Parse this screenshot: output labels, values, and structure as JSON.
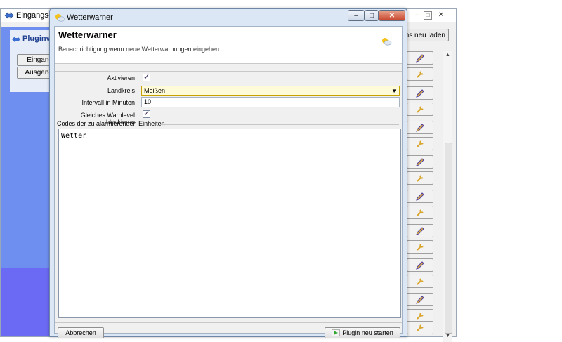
{
  "background_window": {
    "title": "Eingangs- u",
    "panel_title": "Pluginve",
    "buttons": [
      "Eingang",
      "Ausgang"
    ],
    "reload_label": "ns neu laden",
    "controls": [
      "–",
      "□",
      "✕"
    ]
  },
  "dialog": {
    "title": "Wetterwarner",
    "controls": [
      "–",
      "□",
      "✕"
    ],
    "header_title": "Wetterwarner",
    "header_subtitle": "Benachrichtigung wenn neue Wetterwarnungen eingehen.",
    "fields": {
      "aktivieren_label": "Aktivieren",
      "aktivieren_checked": true,
      "landkreis_label": "Landkreis",
      "landkreis_value": "Meißen",
      "intervall_label": "Intervall in Minuten",
      "intervall_value": "10",
      "warnlevel_label": "Gleiches Warnlevel blockieren",
      "warnlevel_checked": true
    },
    "codes_label": "Codes der zu alarmierenden Einheiten",
    "codes_value": "Wetter",
    "cancel_label": "Abbrechen",
    "restart_label": "Plugin neu starten"
  }
}
